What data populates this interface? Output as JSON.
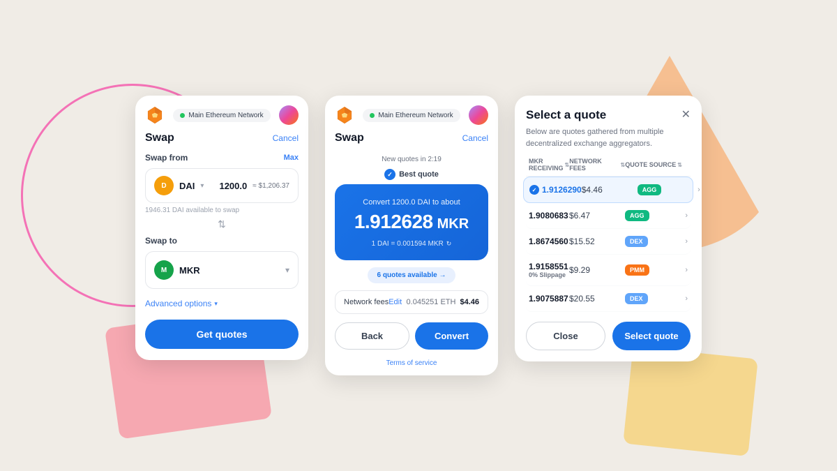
{
  "background": {
    "color": "#f0ece6"
  },
  "card1": {
    "title": "Swap",
    "cancel_label": "Cancel",
    "network": "Main Ethereum Network",
    "swap_from_label": "Swap from",
    "max_label": "Max",
    "from_token": "DAI",
    "from_amount": "1200.0",
    "from_usd": "≈ $1,206.37",
    "available": "1946.31 DAI available to swap",
    "swap_to_label": "Swap to",
    "to_token": "MKR",
    "advanced_options": "Advanced options",
    "get_quotes_label": "Get quotes"
  },
  "card2": {
    "title": "Swap",
    "cancel_label": "Cancel",
    "network": "Main Ethereum Network",
    "new_quotes": "New quotes in 2:19",
    "best_quote_label": "Best quote",
    "convert_subtitle": "Convert 1200.0 DAI to about",
    "convert_amount": "1.912628",
    "convert_token": "MKR",
    "rate": "1 DAI = 0.001594 MKR",
    "quotes_available": "6 quotes available →",
    "network_fees_label": "Network fees",
    "edit_label": "Edit",
    "fees_eth": "0.045251 ETH",
    "fees_usd": "$4.46",
    "back_label": "Back",
    "convert_label": "Convert",
    "terms_label": "Terms of service"
  },
  "card3": {
    "title": "Select a quote",
    "description": "Below are quotes gathered from multiple decentralized exchange aggregators.",
    "col_receiving": "MKR Receiving",
    "col_fees": "Network fees",
    "col_source": "Quote source",
    "quotes": [
      {
        "receiving": "1.9126290",
        "fee": "$4.46",
        "source": "AGG",
        "source_type": "agg",
        "active": true,
        "slippage": ""
      },
      {
        "receiving": "1.9080683",
        "fee": "$6.47",
        "source": "AGG",
        "source_type": "agg",
        "active": false,
        "slippage": ""
      },
      {
        "receiving": "1.8674560",
        "fee": "$15.52",
        "source": "DEX",
        "source_type": "dex",
        "active": false,
        "slippage": ""
      },
      {
        "receiving": "1.9158551",
        "fee": "$9.29",
        "source": "PMM",
        "source_type": "pmm",
        "active": false,
        "slippage": "0% Slippage"
      },
      {
        "receiving": "1.9075887",
        "fee": "$20.55",
        "source": "DEX",
        "source_type": "dex",
        "active": false,
        "slippage": ""
      }
    ],
    "close_label": "Close",
    "select_quote_label": "Select quote"
  }
}
